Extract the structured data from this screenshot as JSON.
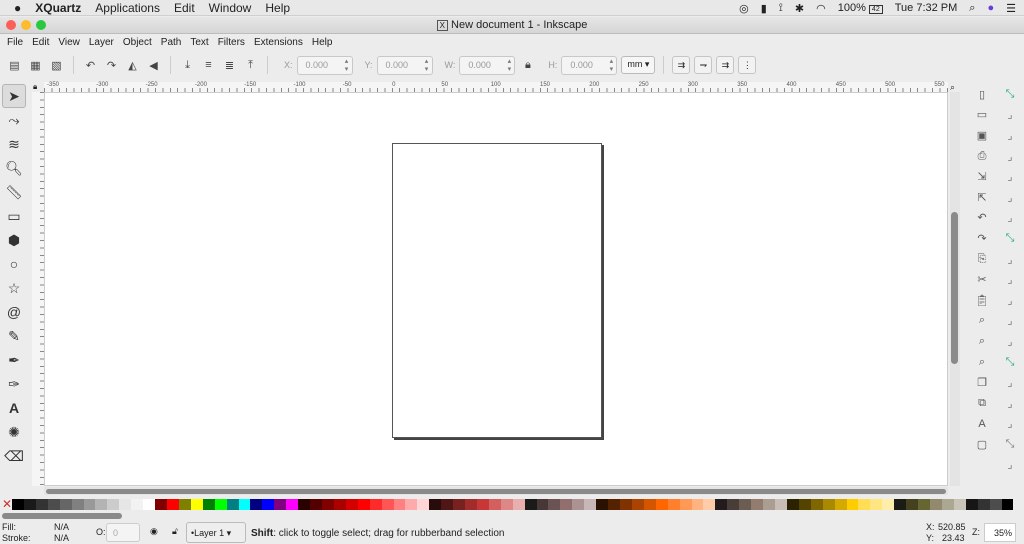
{
  "macbar": {
    "app": "XQuartz",
    "menus": [
      "Applications",
      "Edit",
      "Window",
      "Help"
    ],
    "battery": "100%",
    "battery_badge": "42",
    "clock": "Tue 7:32 PM"
  },
  "window": {
    "title": "New document 1 - Inkscape"
  },
  "menu": [
    "File",
    "Edit",
    "View",
    "Layer",
    "Object",
    "Path",
    "Text",
    "Filters",
    "Extensions",
    "Help"
  ],
  "toolbar": {
    "x_label": "X:",
    "x": "0.000",
    "y_label": "Y:",
    "y": "0.000",
    "w_label": "W:",
    "w": "0.000",
    "h_label": "H:",
    "h": "0.000",
    "unit": "mm"
  },
  "ruler": {
    "ticks": [
      "-350",
      "-300",
      "-250",
      "-200",
      "-150",
      "-100",
      "-50",
      "0",
      "50",
      "100",
      "150",
      "200",
      "250",
      "300",
      "350",
      "400",
      "450",
      "500",
      "550"
    ]
  },
  "tools": [
    "selector",
    "node",
    "tweak",
    "zoom",
    "measure",
    "rectangle",
    "3d-box",
    "ellipse",
    "star",
    "spiral",
    "pencil",
    "pen",
    "calligraphy",
    "text",
    "spray",
    "eraser"
  ],
  "palette": [
    "#000000",
    "#1a1a1a",
    "#333333",
    "#4d4d4d",
    "#666666",
    "#808080",
    "#999999",
    "#b3b3b3",
    "#cccccc",
    "#e6e6e6",
    "#f2f2f2",
    "#ffffff",
    "#800000",
    "#ff0000",
    "#808000",
    "#ffff00",
    "#008000",
    "#00ff00",
    "#008080",
    "#00ffff",
    "#000080",
    "#0000ff",
    "#800080",
    "#ff00ff",
    "#2b0000",
    "#550000",
    "#800000",
    "#aa0000",
    "#d40000",
    "#ff0000",
    "#ff2a2a",
    "#ff5555",
    "#ff8080",
    "#ffaaaa",
    "#ffd5d5",
    "#280b0b",
    "#501616",
    "#782121",
    "#a02c2c",
    "#c83737",
    "#d35f5f",
    "#de8787",
    "#e9afaf",
    "#1a1a1a",
    "#483737",
    "#6c5353",
    "#916f6f",
    "#ac9393",
    "#c8b7b7",
    "#2b1100",
    "#552200",
    "#803300",
    "#aa4400",
    "#d45500",
    "#ff6600",
    "#ff7f2a",
    "#ff9955",
    "#ffb380",
    "#ffccaa",
    "#241c1c",
    "#483e37",
    "#6c5d53",
    "#917c6f",
    "#ac9d93",
    "#c8beb7",
    "#2b2200",
    "#554400",
    "#806600",
    "#aa8800",
    "#d4aa00",
    "#ffcc00",
    "#ffdd55",
    "#ffe680",
    "#ffeeaa",
    "#1c1c17",
    "#45411f",
    "#666630",
    "#918a6f",
    "#aca793",
    "#c8c4b7",
    "#161616",
    "#333333",
    "#4d4d4d",
    "#000000"
  ],
  "status": {
    "fill_label": "Fill:",
    "fill": "N/A",
    "stroke_label": "Stroke:",
    "stroke": "N/A",
    "opacity_label": "O:",
    "opacity": "0",
    "layer": "•Layer 1",
    "message_bold": "Shift",
    "message": ": click to toggle select; drag for rubberband selection",
    "x_label": "X:",
    "x": "520.85",
    "y_label": "Y:",
    "y": "23.43",
    "zoom_label": "Z:",
    "zoom": "35%"
  }
}
